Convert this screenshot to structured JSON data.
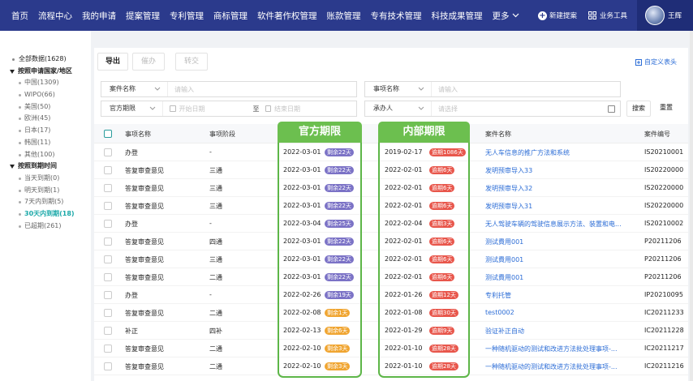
{
  "nav": {
    "items": [
      "首页",
      "流程中心",
      "我的申请",
      "提案管理",
      "专利管理",
      "商标管理",
      "软件著作权管理",
      "账款管理",
      "专有技术管理",
      "科技成果管理"
    ],
    "more": "更多",
    "new_case": "新建提案",
    "biz_tools": "业务工具",
    "username": "王辉"
  },
  "sidebar": {
    "all": "全部数据(1628)",
    "group_country": "按照申请国家/地区",
    "countries": [
      "中国(1309)",
      "WIPO(66)",
      "美国(50)",
      "欧洲(45)",
      "日本(17)",
      "韩国(11)",
      "其他(100)"
    ],
    "group_due": "按照到期时间",
    "due": [
      "当天到期(0)",
      "明天到期(1)",
      "7天内到期(5)",
      "30天内到期(18)",
      "已超期(261)"
    ]
  },
  "toolbar": {
    "export": "导出",
    "urge": "催办",
    "transfer": "转交",
    "custom_header": "自定义表头"
  },
  "filters": {
    "matter_name_label": "案件名称",
    "matter_name_placeholder": "请输入",
    "item_name_label": "事项名称",
    "item_name_placeholder": "请输入",
    "official_label": "官方期限",
    "start_placeholder": "开始日期",
    "to": "至",
    "end_placeholder": "结束日期",
    "handler_label": "承办人",
    "handler_placeholder": "请选择",
    "search": "搜索",
    "reset": "重置"
  },
  "table": {
    "headers": {
      "name": "事项名称",
      "stage": "事项阶段",
      "case": "案件名称",
      "no": "案件编号"
    },
    "rows": [
      {
        "name": "办登",
        "stage": "-",
        "odate": "2022-03-01",
        "otag": "剩余22天",
        "ocolor": "purple",
        "idate": "2019-02-17",
        "itag": "逾期1086天",
        "case": "无人车信息的推广方法和系统",
        "no": "IS20210001"
      },
      {
        "name": "答复审查意见",
        "stage": "三通",
        "odate": "2022-03-01",
        "otag": "剩余22天",
        "ocolor": "purple",
        "idate": "2022-02-01",
        "itag": "逾期6天",
        "case": "发明预审导入33",
        "no": "IS20220000"
      },
      {
        "name": "答复审查意见",
        "stage": "三通",
        "odate": "2022-03-01",
        "otag": "剩余22天",
        "ocolor": "purple",
        "idate": "2022-02-01",
        "itag": "逾期6天",
        "case": "发明预审导入32",
        "no": "IS20220000"
      },
      {
        "name": "答复审查意见",
        "stage": "三通",
        "odate": "2022-03-01",
        "otag": "剩余22天",
        "ocolor": "purple",
        "idate": "2022-02-01",
        "itag": "逾期6天",
        "case": "发明预审导入31",
        "no": "IS20220000"
      },
      {
        "name": "办登",
        "stage": "-",
        "odate": "2022-03-04",
        "otag": "剩余25天",
        "ocolor": "purple",
        "idate": "2022-02-04",
        "itag": "逾期3天",
        "case": "无人驾驶车辆的驾驶信息展示方法、装置和电...",
        "no": "IS20210002"
      },
      {
        "name": "答复审查意见",
        "stage": "四通",
        "odate": "2022-03-01",
        "otag": "剩余22天",
        "ocolor": "purple",
        "idate": "2022-02-01",
        "itag": "逾期6天",
        "case": "测试費用001",
        "no": "P20211206"
      },
      {
        "name": "答复审查意见",
        "stage": "三通",
        "odate": "2022-03-01",
        "otag": "剩余22天",
        "ocolor": "purple",
        "idate": "2022-02-01",
        "itag": "逾期6天",
        "case": "测试費用001",
        "no": "P20211206"
      },
      {
        "name": "答复审查意见",
        "stage": "二通",
        "odate": "2022-03-01",
        "otag": "剩余22天",
        "ocolor": "purple",
        "idate": "2022-02-01",
        "itag": "逾期6天",
        "case": "测试費用001",
        "no": "P20211206"
      },
      {
        "name": "办登",
        "stage": "-",
        "odate": "2022-02-26",
        "otag": "剩余19天",
        "ocolor": "purple",
        "idate": "2022-01-26",
        "itag": "逾期12天",
        "case": "专利托管",
        "no": "IP20210095"
      },
      {
        "name": "答复审查意见",
        "stage": "二通",
        "odate": "2022-02-08",
        "otag": "剩余1天",
        "ocolor": "orange",
        "idate": "2022-01-08",
        "itag": "逾期30天",
        "case": "test0002",
        "no": "IC20211233"
      },
      {
        "name": "补正",
        "stage": "四补",
        "odate": "2022-02-13",
        "otag": "剩余6天",
        "ocolor": "orange",
        "idate": "2022-01-29",
        "itag": "逾期9天",
        "case": "验证补正自动",
        "no": "IC20211228"
      },
      {
        "name": "答复审查意见",
        "stage": "二通",
        "odate": "2022-02-10",
        "otag": "剩余3天",
        "ocolor": "orange",
        "idate": "2022-01-10",
        "itag": "逾期28天",
        "case": "一种随机驱动的测试和改进方法批处理事项-...",
        "no": "IC20211217"
      },
      {
        "name": "答复审查意见",
        "stage": "二通",
        "odate": "2022-02-10",
        "otag": "剩余3天",
        "ocolor": "orange",
        "idate": "2022-01-10",
        "itag": "逾期28天",
        "case": "一种随机驱动的测试和改进方法批处理事项-...",
        "no": "IC20211216"
      }
    ]
  },
  "highlights": {
    "official": "官方期限",
    "internal": "内部期限"
  },
  "colors": {
    "nav_bg": "#2b3a8c",
    "highlight_green": "#5db648",
    "tag_purple": "#7b72c6",
    "tag_orange": "#f0a531",
    "tag_red": "#e8564b",
    "link_blue": "#2b6cd6",
    "active_teal": "#1aa8a8"
  }
}
